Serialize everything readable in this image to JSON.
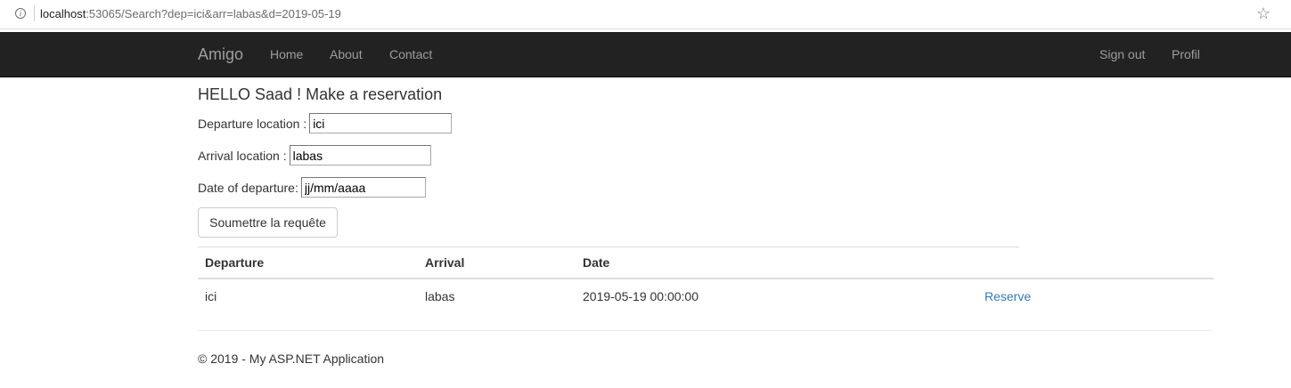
{
  "browser": {
    "url_host": "localhost",
    "url_rest": ":53065/Search?dep=ici&arr=labas&d=2019-05-19",
    "info_glyph": "i",
    "bookmark_glyph": "☆"
  },
  "navbar": {
    "brand": "Amigo",
    "links": [
      "Home",
      "About",
      "Contact"
    ],
    "right_links": [
      "Sign out",
      "Profil"
    ]
  },
  "form": {
    "greeting": "HELLO Saad ! Make a reservation",
    "departure_label": "Departure location :",
    "departure_value": "ici",
    "arrival_label": "Arrival location :",
    "arrival_value": "labas",
    "date_label": "Date of departure:",
    "date_value": "jj/mm/aaaa",
    "submit_label": "Soumettre la requête"
  },
  "table": {
    "headers": [
      "Departure",
      "Arrival",
      "Date",
      ""
    ],
    "rows": [
      {
        "departure": "ici",
        "arrival": "labas",
        "date": "2019-05-19 00:00:00",
        "action": "Reserve"
      }
    ]
  },
  "footer": {
    "text": "© 2019 - My ASP.NET Application"
  },
  "colors": {
    "navbar_bg": "#222222",
    "nav_text": "#9d9d9d",
    "link": "#337ab7"
  }
}
